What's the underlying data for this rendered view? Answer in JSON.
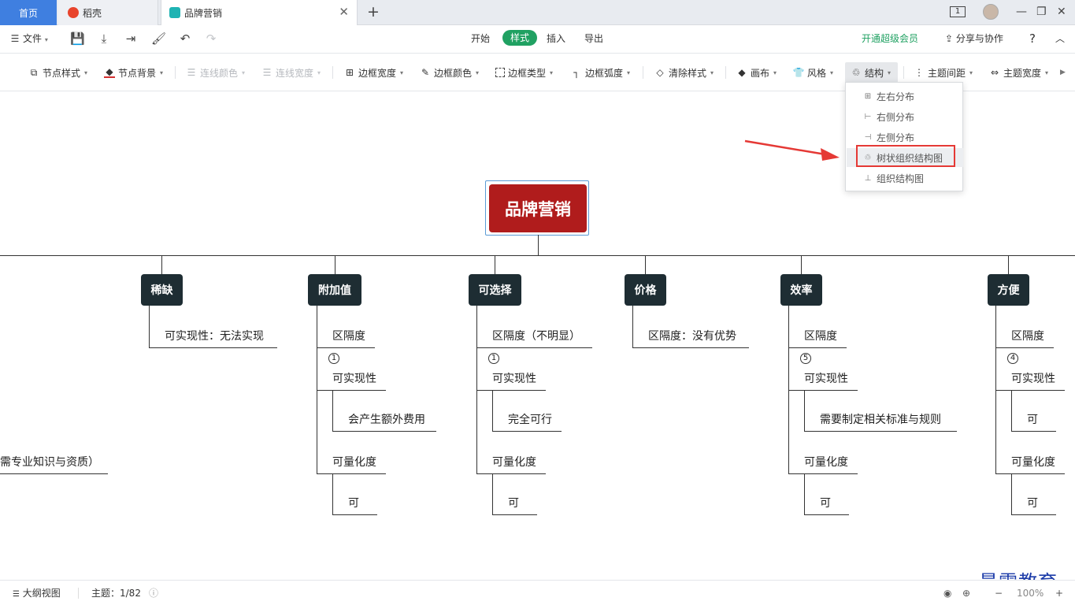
{
  "tabs": {
    "home": "首页",
    "daoke": "稻壳",
    "doc": "品牌营销"
  },
  "window": {
    "page_badge": "1"
  },
  "menubar": {
    "file": "文件",
    "tabs": [
      "开始",
      "样式",
      "插入",
      "导出"
    ],
    "vip": "开通超级会员",
    "share": "分享与协作",
    "help": "?"
  },
  "toolbar": {
    "node_style": "节点样式",
    "node_bg": "节点背景",
    "line_color": "连线颜色",
    "line_width": "连线宽度",
    "border_width": "边框宽度",
    "border_color": "边框颜色",
    "border_type": "边框类型",
    "border_radius": "边框弧度",
    "clear_style": "清除样式",
    "canvas": "画布",
    "theme": "风格",
    "structure": "结构",
    "topic_spacing": "主题间距",
    "topic_width": "主题宽度"
  },
  "structure_menu": {
    "items": [
      "左右分布",
      "右侧分布",
      "左侧分布",
      "树状组织结构图",
      "组织结构图"
    ],
    "highlighted": "树状组织结构图"
  },
  "mindmap": {
    "root": "品牌营销",
    "left_cut_text": "需专业知识与资质）",
    "branches": [
      {
        "title": "稀缺",
        "items": [
          "可实现性：无法实现"
        ]
      },
      {
        "title": "附加值",
        "items": [
          "区隔度",
          "1",
          "可实现性",
          "会产生额外费用",
          "可量化度",
          "可"
        ]
      },
      {
        "title": "可选择",
        "items": [
          "区隔度（不明显）",
          "1",
          "可实现性",
          "完全可行",
          "可量化度",
          "可"
        ]
      },
      {
        "title": "价格",
        "items": [
          "区隔度：没有优势"
        ]
      },
      {
        "title": "效率",
        "items": [
          "区隔度",
          "5",
          "可实现性",
          "需要制定相关标准与规则",
          "可量化度",
          "可"
        ]
      },
      {
        "title": "方便",
        "items": [
          "区隔度",
          "4",
          "可实现性",
          "可",
          "可量化度",
          "可"
        ]
      }
    ]
  },
  "status": {
    "outline": "大纲视图",
    "topic_count": "主题：1/82",
    "zoom": "100%"
  },
  "watermark": "最需教育",
  "colors": {
    "root": "#b01c1c",
    "topic": "#1e2d33",
    "accent_green": "#20a162",
    "home_tab": "#3f7fe0",
    "arrow": "#e53935"
  }
}
